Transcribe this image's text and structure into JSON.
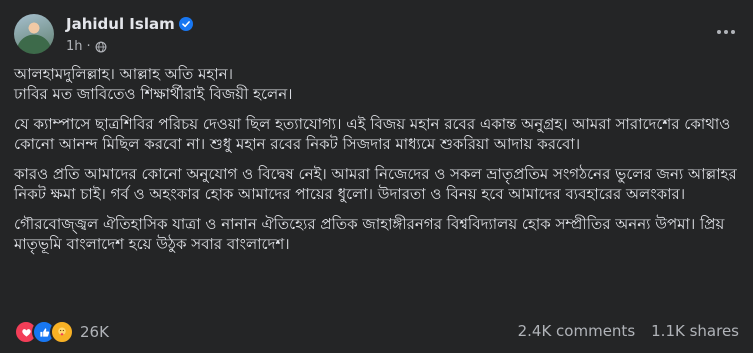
{
  "author": {
    "name": "Jahidul Islam",
    "time": "1h"
  },
  "post": {
    "paragraphs": [
      "আলহামদুলিল্লাহ। আল্লাহ অতি মহান।\nঢাবির মত জাবিতেও শিক্ষার্থীরাই বিজয়ী হলেন।",
      "যে ক্যাম্পাসে ছাত্রশিবির পরিচয় দেওয়া ছিল হত্যাযোগ্য। এই বিজয় মহান রবের একান্ত অনুগ্রহ। আমরা সারাদেশের কোথাও কোনো আনন্দ মিছিল করবো না। শুধু মহান রবের নিকট সিজদার মাধ্যমে শুকরিয়া আদায় করবো।",
      "কারও প্রতি আমাদের কোনো অনুযোগ ও বিদ্বেষ নেই। আমরা নিজেদের ও সকল ভ্রাতৃপ্রতিম সংগঠনের ভুলের জন্য আল্লাহর নিকট ক্ষমা চাই। গর্ব ও অহংকার হোক আমাদের পায়ের ধুলো। উদারতা ও বিনয় হবে আমাদের ব্যবহারের অলংকার।",
      "গৌরবোজ্জ্বল ঐতিহাসিক যাত্রা ও নানান ঐতিহ্যের প্রতিক  জাহাঙ্গীরনগর বিশ্ববিদ্যালয় হোক সম্প্রীতির অনন্য উপমা। প্রিয় মাতৃভূমি বাংলাদেশ হয়ে উঠুক সবার বাংলাদেশ।"
    ]
  },
  "engagement": {
    "reactions": [
      "love",
      "like",
      "care"
    ],
    "reaction_count": "26K",
    "comments": "2.4K comments",
    "shares": "1.1K shares"
  },
  "colors": {
    "background": "#242526",
    "text": "#e4e6eb",
    "secondary": "#b0b3b8",
    "brand": "#1877f2"
  }
}
